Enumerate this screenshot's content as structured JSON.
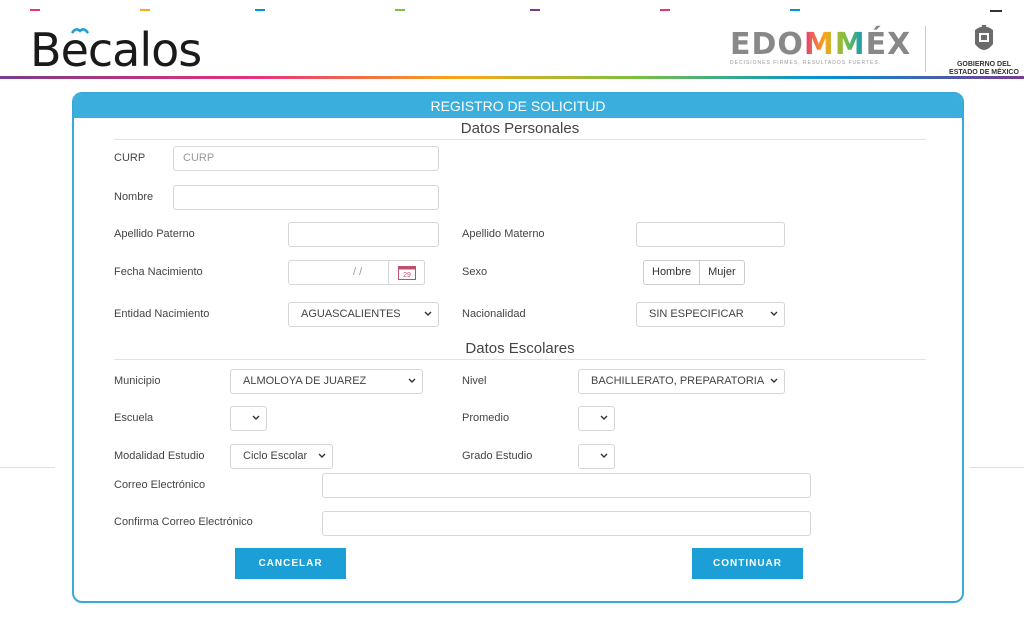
{
  "header": {
    "brand": "Bēcalos",
    "brand_prefix": "B",
    "brand_e": "e",
    "brand_suffix": "calos",
    "edomex_left": "EDO",
    "edomex_mid": "MM",
    "edomex_right": "ÉX",
    "edomex_tagline": "DECISIONES FIRMES, RESULTADOS FUERTES.",
    "gob_line1": "GOBIERNO DEL",
    "gob_line2": "ESTADO DE MÉXICO"
  },
  "form": {
    "title": "REGISTRO DE SOLICITUD",
    "personal_section": "Datos Personales",
    "school_section": "Datos Escolares",
    "curp_label": "CURP",
    "curp_placeholder": "CURP",
    "nombre_label": "Nombre",
    "apellido_paterno_label": "Apellido Paterno",
    "apellido_materno_label": "Apellido Materno",
    "fecha_label": "Fecha Nacimiento",
    "fecha_value": "/ /",
    "calendar_day": "29",
    "sexo_label": "Sexo",
    "sexo_options": [
      "Hombre",
      "Mujer"
    ],
    "entidad_label": "Entidad Nacimiento",
    "entidad_value": "AGUASCALIENTES",
    "nacionalidad_label": "Nacionalidad",
    "nacionalidad_value": "SIN ESPECIFICAR",
    "municipio_label": "Municipio",
    "municipio_value": "ALMOLOYA DE JUAREZ",
    "nivel_label": "Nivel",
    "nivel_value": "BACHILLERATO, PREPARATORIA",
    "escuela_label": "Escuela",
    "escuela_value": "",
    "promedio_label": "Promedio",
    "promedio_value": "",
    "modalidad_label": "Modalidad Estudio",
    "modalidad_value": "Ciclo Escolar",
    "grado_label": "Grado Estudio",
    "grado_value": "",
    "correo_label": "Correo Electrónico",
    "confirma_label": "Confirma Correo Electrónico",
    "cancel_label": "CANCELAR",
    "continue_label": "CONTINUAR"
  },
  "colors": {
    "primary": "#1b9fd6",
    "panel_header": "#3aaedc",
    "panel_border": "#39a9d9"
  },
  "icons": [
    "book-icon",
    "calendar-icon",
    "chevron-down-icon",
    "state-seal-icon"
  ]
}
